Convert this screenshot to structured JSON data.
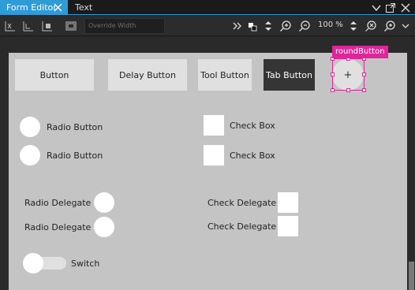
{
  "tabs": [
    {
      "label": "Form Editor",
      "active": true
    },
    {
      "label": "Text Editor",
      "active": false
    }
  ],
  "toolbar": {
    "override_placeholder": "Override Width",
    "zoom": "100 %"
  },
  "form": {
    "buttons": {
      "button": "Button",
      "delay_button": "Delay Button",
      "tool_button": "Tool Button",
      "tab_button": "Tab Button",
      "round_button_glyph": "+"
    },
    "selection_label": "roundButton",
    "radio_buttons": [
      "Radio Button",
      "Radio Button"
    ],
    "check_boxes": [
      "Check Box",
      "Check Box"
    ],
    "radio_delegates": [
      "Radio Delegate",
      "Radio Delegate"
    ],
    "check_delegates": [
      "Check Delegate",
      "Check Delegate"
    ],
    "switch_label": "Switch"
  },
  "colors": {
    "accent": "#2f9bd7",
    "selection": "#e0249a",
    "form_bg": "#c4c4c4",
    "dark_button": "#353535"
  }
}
